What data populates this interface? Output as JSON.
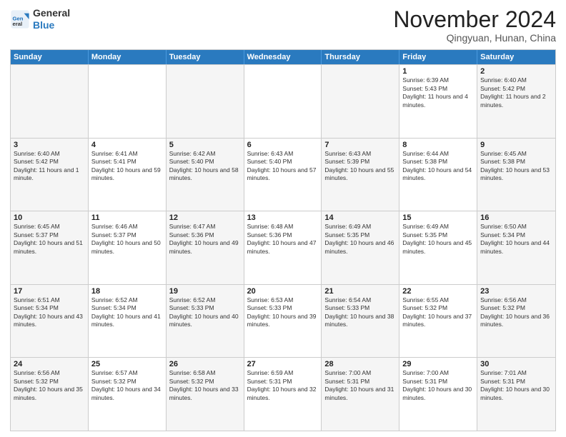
{
  "header": {
    "logo_line1": "General",
    "logo_line2": "Blue",
    "month_title": "November 2024",
    "location": "Qingyuan, Hunan, China"
  },
  "weekdays": [
    "Sunday",
    "Monday",
    "Tuesday",
    "Wednesday",
    "Thursday",
    "Friday",
    "Saturday"
  ],
  "weeks": [
    [
      {
        "day": "",
        "sunrise": "",
        "sunset": "",
        "daylight": ""
      },
      {
        "day": "",
        "sunrise": "",
        "sunset": "",
        "daylight": ""
      },
      {
        "day": "",
        "sunrise": "",
        "sunset": "",
        "daylight": ""
      },
      {
        "day": "",
        "sunrise": "",
        "sunset": "",
        "daylight": ""
      },
      {
        "day": "",
        "sunrise": "",
        "sunset": "",
        "daylight": ""
      },
      {
        "day": "1",
        "sunrise": "Sunrise: 6:39 AM",
        "sunset": "Sunset: 5:43 PM",
        "daylight": "Daylight: 11 hours and 4 minutes."
      },
      {
        "day": "2",
        "sunrise": "Sunrise: 6:40 AM",
        "sunset": "Sunset: 5:42 PM",
        "daylight": "Daylight: 11 hours and 2 minutes."
      }
    ],
    [
      {
        "day": "3",
        "sunrise": "Sunrise: 6:40 AM",
        "sunset": "Sunset: 5:42 PM",
        "daylight": "Daylight: 11 hours and 1 minute."
      },
      {
        "day": "4",
        "sunrise": "Sunrise: 6:41 AM",
        "sunset": "Sunset: 5:41 PM",
        "daylight": "Daylight: 10 hours and 59 minutes."
      },
      {
        "day": "5",
        "sunrise": "Sunrise: 6:42 AM",
        "sunset": "Sunset: 5:40 PM",
        "daylight": "Daylight: 10 hours and 58 minutes."
      },
      {
        "day": "6",
        "sunrise": "Sunrise: 6:43 AM",
        "sunset": "Sunset: 5:40 PM",
        "daylight": "Daylight: 10 hours and 57 minutes."
      },
      {
        "day": "7",
        "sunrise": "Sunrise: 6:43 AM",
        "sunset": "Sunset: 5:39 PM",
        "daylight": "Daylight: 10 hours and 55 minutes."
      },
      {
        "day": "8",
        "sunrise": "Sunrise: 6:44 AM",
        "sunset": "Sunset: 5:38 PM",
        "daylight": "Daylight: 10 hours and 54 minutes."
      },
      {
        "day": "9",
        "sunrise": "Sunrise: 6:45 AM",
        "sunset": "Sunset: 5:38 PM",
        "daylight": "Daylight: 10 hours and 53 minutes."
      }
    ],
    [
      {
        "day": "10",
        "sunrise": "Sunrise: 6:45 AM",
        "sunset": "Sunset: 5:37 PM",
        "daylight": "Daylight: 10 hours and 51 minutes."
      },
      {
        "day": "11",
        "sunrise": "Sunrise: 6:46 AM",
        "sunset": "Sunset: 5:37 PM",
        "daylight": "Daylight: 10 hours and 50 minutes."
      },
      {
        "day": "12",
        "sunrise": "Sunrise: 6:47 AM",
        "sunset": "Sunset: 5:36 PM",
        "daylight": "Daylight: 10 hours and 49 minutes."
      },
      {
        "day": "13",
        "sunrise": "Sunrise: 6:48 AM",
        "sunset": "Sunset: 5:36 PM",
        "daylight": "Daylight: 10 hours and 47 minutes."
      },
      {
        "day": "14",
        "sunrise": "Sunrise: 6:49 AM",
        "sunset": "Sunset: 5:35 PM",
        "daylight": "Daylight: 10 hours and 46 minutes."
      },
      {
        "day": "15",
        "sunrise": "Sunrise: 6:49 AM",
        "sunset": "Sunset: 5:35 PM",
        "daylight": "Daylight: 10 hours and 45 minutes."
      },
      {
        "day": "16",
        "sunrise": "Sunrise: 6:50 AM",
        "sunset": "Sunset: 5:34 PM",
        "daylight": "Daylight: 10 hours and 44 minutes."
      }
    ],
    [
      {
        "day": "17",
        "sunrise": "Sunrise: 6:51 AM",
        "sunset": "Sunset: 5:34 PM",
        "daylight": "Daylight: 10 hours and 43 minutes."
      },
      {
        "day": "18",
        "sunrise": "Sunrise: 6:52 AM",
        "sunset": "Sunset: 5:34 PM",
        "daylight": "Daylight: 10 hours and 41 minutes."
      },
      {
        "day": "19",
        "sunrise": "Sunrise: 6:52 AM",
        "sunset": "Sunset: 5:33 PM",
        "daylight": "Daylight: 10 hours and 40 minutes."
      },
      {
        "day": "20",
        "sunrise": "Sunrise: 6:53 AM",
        "sunset": "Sunset: 5:33 PM",
        "daylight": "Daylight: 10 hours and 39 minutes."
      },
      {
        "day": "21",
        "sunrise": "Sunrise: 6:54 AM",
        "sunset": "Sunset: 5:33 PM",
        "daylight": "Daylight: 10 hours and 38 minutes."
      },
      {
        "day": "22",
        "sunrise": "Sunrise: 6:55 AM",
        "sunset": "Sunset: 5:32 PM",
        "daylight": "Daylight: 10 hours and 37 minutes."
      },
      {
        "day": "23",
        "sunrise": "Sunrise: 6:56 AM",
        "sunset": "Sunset: 5:32 PM",
        "daylight": "Daylight: 10 hours and 36 minutes."
      }
    ],
    [
      {
        "day": "24",
        "sunrise": "Sunrise: 6:56 AM",
        "sunset": "Sunset: 5:32 PM",
        "daylight": "Daylight: 10 hours and 35 minutes."
      },
      {
        "day": "25",
        "sunrise": "Sunrise: 6:57 AM",
        "sunset": "Sunset: 5:32 PM",
        "daylight": "Daylight: 10 hours and 34 minutes."
      },
      {
        "day": "26",
        "sunrise": "Sunrise: 6:58 AM",
        "sunset": "Sunset: 5:32 PM",
        "daylight": "Daylight: 10 hours and 33 minutes."
      },
      {
        "day": "27",
        "sunrise": "Sunrise: 6:59 AM",
        "sunset": "Sunset: 5:31 PM",
        "daylight": "Daylight: 10 hours and 32 minutes."
      },
      {
        "day": "28",
        "sunrise": "Sunrise: 7:00 AM",
        "sunset": "Sunset: 5:31 PM",
        "daylight": "Daylight: 10 hours and 31 minutes."
      },
      {
        "day": "29",
        "sunrise": "Sunrise: 7:00 AM",
        "sunset": "Sunset: 5:31 PM",
        "daylight": "Daylight: 10 hours and 30 minutes."
      },
      {
        "day": "30",
        "sunrise": "Sunrise: 7:01 AM",
        "sunset": "Sunset: 5:31 PM",
        "daylight": "Daylight: 10 hours and 30 minutes."
      }
    ]
  ]
}
